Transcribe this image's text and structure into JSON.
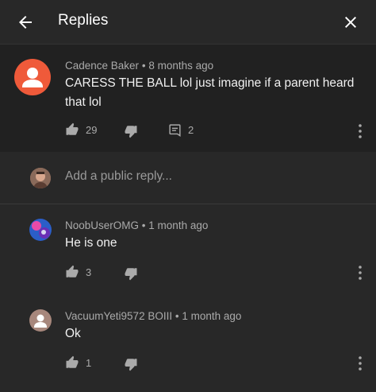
{
  "header": {
    "title": "Replies",
    "back_icon": "arrow-left-icon",
    "close_icon": "close-icon"
  },
  "top_comment": {
    "author": "Cadence Baker",
    "time": "8 months ago",
    "separator": "•",
    "text": "CARESS THE BALL  lol just imagine if a parent heard that lol",
    "likes": "29",
    "replies": "2"
  },
  "reply_box": {
    "placeholder": "Add a public reply..."
  },
  "replies": [
    {
      "author": "NoobUserOMG",
      "time": "1 month ago",
      "separator": "•",
      "text": "He is one",
      "likes": "3"
    },
    {
      "author": "VacuumYeti9572 BOIII",
      "time": "1 month ago",
      "separator": "•",
      "text": "Ok",
      "likes": "1"
    }
  ],
  "colors": {
    "background": "#282828",
    "highlight": "#212121",
    "avatar_orange": "#ef5a3a"
  }
}
